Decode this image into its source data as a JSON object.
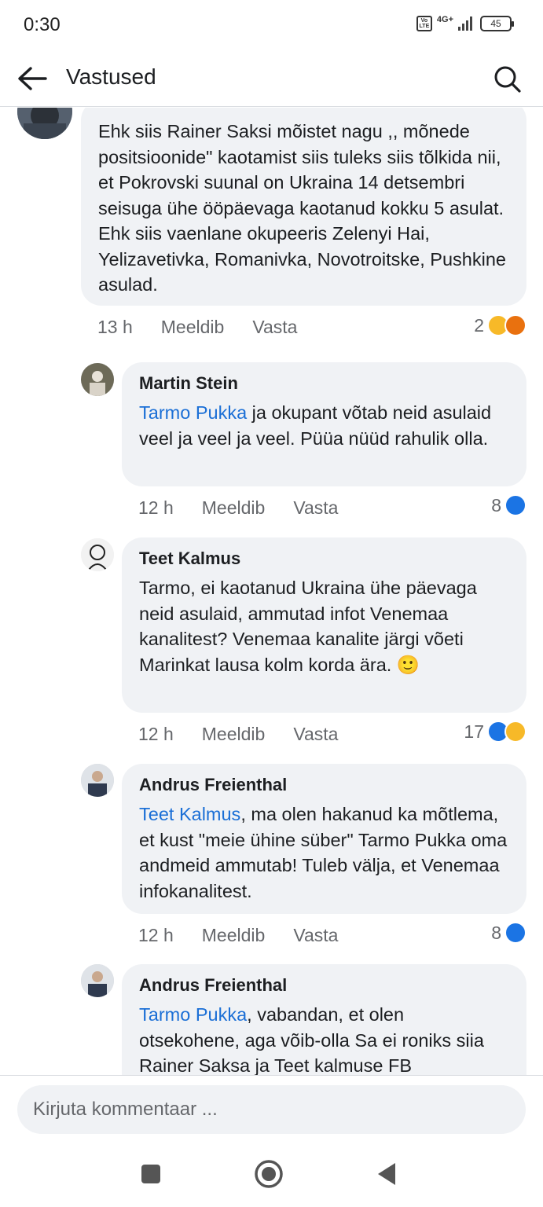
{
  "status_bar": {
    "time": "0:30",
    "network": "4G+",
    "volte": "Vo LTE",
    "battery": "45"
  },
  "app_bar": {
    "title": "Vastused"
  },
  "comments": [
    {
      "author": "",
      "mention": "",
      "text": "Ehk siis Rainer Saksi mõistet nagu ,, mõnede positsioonide\" kaotamist siis tuleks siis tõlkida nii, et Pokrovski suunal on Ukraina 14 detsembri seisuga ühe ööpäevaga kaotanud kokku 5 asulat. Ehk siis vaenlane okupeeris Zelenyi Hai, Yelizavetivka, Romanivka, Novotroitske, Pushkine asulad.",
      "time": "13 h",
      "like": "Meeldib",
      "reply": "Vasta",
      "reaction_count": "2",
      "reactions": [
        "haha",
        "angry"
      ]
    },
    {
      "author": "Martin Stein",
      "mention": "Tarmo Pukka",
      "text": " ja okupant võtab neid asulaid veel ja veel ja veel. Püüa nüüd rahulik olla.",
      "time": "12 h",
      "like": "Meeldib",
      "reply": "Vasta",
      "reaction_count": "8",
      "reactions": [
        "like"
      ]
    },
    {
      "author": "Teet Kalmus",
      "mention": "",
      "text": "Tarmo, ei kaotanud Ukraina ühe päevaga neid asulaid, ammutad infot Venemaa kanalitest? Venemaa kanalite järgi võeti Marinkat lausa kolm korda ära. 🙂",
      "time": "12 h",
      "like": "Meeldib",
      "reply": "Vasta",
      "reaction_count": "17",
      "reactions": [
        "like",
        "haha"
      ]
    },
    {
      "author": "Andrus Freienthal",
      "mention": "Teet Kalmus",
      "text": ", ma olen hakanud ka mõtlema, et kust \"meie ühine süber\" Tarmo Pukka oma andmeid ammutab! Tuleb välja, et Venemaa infokanalitest.",
      "time": "12 h",
      "like": "Meeldib",
      "reply": "Vasta",
      "reaction_count": "8",
      "reactions": [
        "like"
      ]
    },
    {
      "author": "Andrus Freienthal",
      "mention": "Tarmo Pukka",
      "text": ", vabandan, et olen otsekohene, aga võib-olla Sa ei roniks siia Rainer Saksa ja Teet kalmuse FB",
      "time": "",
      "like": "",
      "reply": "",
      "reaction_count": "",
      "reactions": []
    }
  ],
  "composer": {
    "placeholder": "Kirjuta kommentaar ..."
  },
  "colors": {
    "mention": "#1b6fd6",
    "bubble": "#f0f2f5",
    "meta": "#65676b",
    "like": "#1b74e4",
    "haha": "#f7b928",
    "angry": "#e9710f"
  }
}
